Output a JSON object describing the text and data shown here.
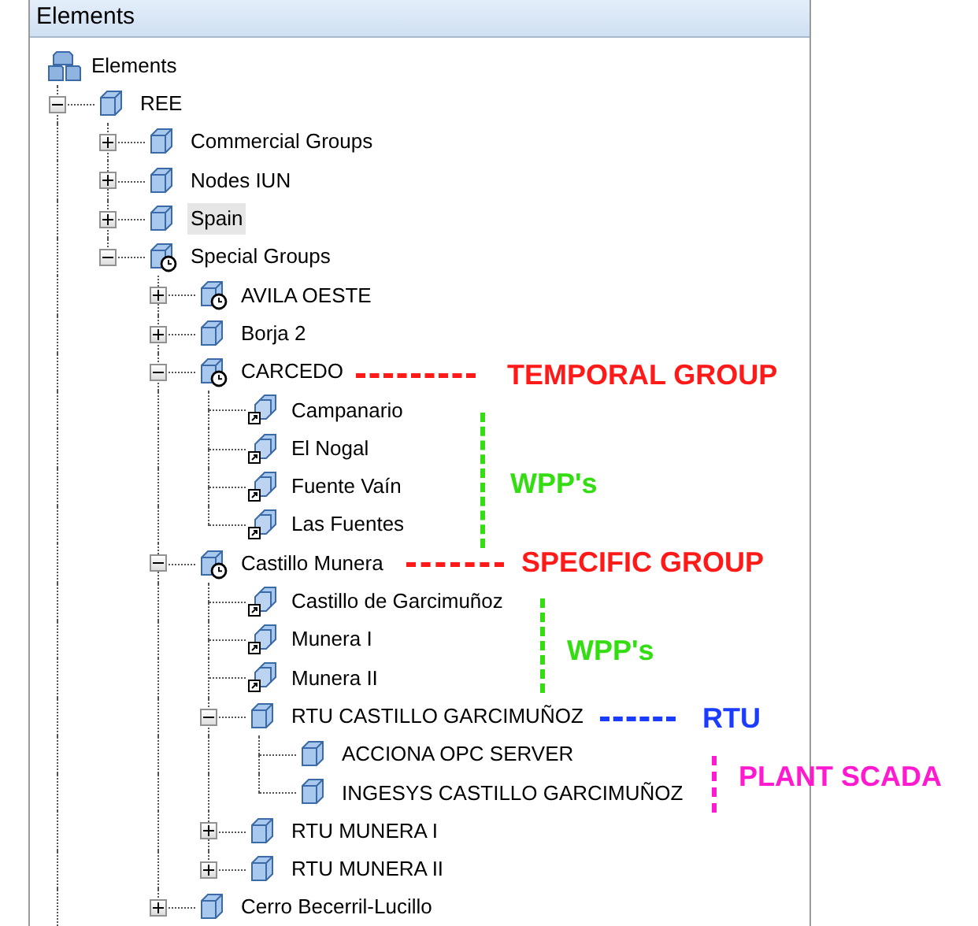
{
  "panel": {
    "title": "Elements"
  },
  "tree": {
    "label": "Elements",
    "kind": "root",
    "children": [
      {
        "label": "REE",
        "kind": "cube",
        "expanded": true,
        "selected": false,
        "more_below": true,
        "children": [
          {
            "label": "Commercial Groups",
            "kind": "cube",
            "expanded": false,
            "selected": false
          },
          {
            "label": "Nodes IUN",
            "kind": "cube",
            "expanded": false,
            "selected": false
          },
          {
            "label": "Spain",
            "kind": "cube",
            "expanded": false,
            "selected": true
          },
          {
            "label": "Special Groups",
            "kind": "group",
            "expanded": true,
            "selected": false,
            "children": [
              {
                "label": "AVILA OESTE",
                "kind": "group",
                "expanded": false,
                "selected": false
              },
              {
                "label": "Borja 2",
                "kind": "cube",
                "expanded": false,
                "selected": false
              },
              {
                "label": "CARCEDO",
                "kind": "group",
                "expanded": true,
                "selected": false,
                "children": [
                  {
                    "label": "Campanario",
                    "kind": "link",
                    "selected": false
                  },
                  {
                    "label": "El Nogal",
                    "kind": "link",
                    "selected": false
                  },
                  {
                    "label": "Fuente Vaín",
                    "kind": "link",
                    "selected": false
                  },
                  {
                    "label": "Las Fuentes",
                    "kind": "link",
                    "selected": false
                  }
                ]
              },
              {
                "label": "Castillo Munera",
                "kind": "group",
                "expanded": true,
                "selected": false,
                "children": [
                  {
                    "label": "Castillo de Garcimuñoz",
                    "kind": "link",
                    "selected": false
                  },
                  {
                    "label": "Munera I",
                    "kind": "link",
                    "selected": false
                  },
                  {
                    "label": "Munera II",
                    "kind": "link",
                    "selected": false
                  },
                  {
                    "label": "RTU CASTILLO GARCIMUÑOZ",
                    "kind": "cube",
                    "expanded": true,
                    "selected": false,
                    "children": [
                      {
                        "label": "ACCIONA OPC SERVER",
                        "kind": "cube",
                        "selected": false
                      },
                      {
                        "label": "INGESYS CASTILLO GARCIMUÑOZ",
                        "kind": "cube",
                        "selected": false
                      }
                    ]
                  },
                  {
                    "label": "RTU MUNERA I",
                    "kind": "cube",
                    "expanded": false,
                    "selected": false
                  },
                  {
                    "label": "RTU MUNERA II",
                    "kind": "cube",
                    "expanded": false,
                    "selected": false
                  }
                ]
              },
              {
                "label": "Cerro Becerril-Lucillo",
                "kind": "cube",
                "expanded": false,
                "selected": false
              }
            ]
          }
        ]
      }
    ]
  },
  "annotations": [
    {
      "text": "TEMPORAL GROUP",
      "color": "#ff1a1a",
      "kind": "horizontal"
    },
    {
      "text": "WPP's",
      "color": "#33dd11",
      "kind": "vertical"
    },
    {
      "text": "SPECIFIC GROUP",
      "color": "#ff1a1a",
      "kind": "horizontal"
    },
    {
      "text": "WPP's",
      "color": "#33dd11",
      "kind": "vertical"
    },
    {
      "text": "RTU",
      "color": "#1a3cff",
      "kind": "horizontal"
    },
    {
      "text": "PLANT SCADA",
      "color": "#ff1ad0",
      "kind": "vertical"
    }
  ]
}
